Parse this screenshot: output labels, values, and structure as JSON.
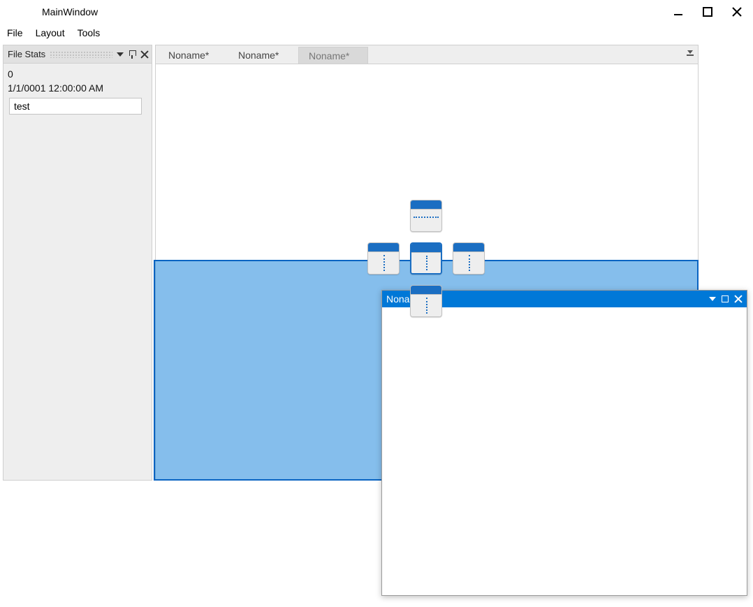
{
  "window": {
    "title": "MainWindow"
  },
  "menu": {
    "items": [
      "File",
      "Layout",
      "Tools"
    ]
  },
  "sidebar": {
    "title": "File Stats",
    "stats": {
      "count": "0",
      "timestamp": "1/1/0001 12:00:00 AM",
      "input_value": "test"
    }
  },
  "tabs": {
    "items": [
      {
        "label": "Noname*",
        "active": false
      },
      {
        "label": "Noname*",
        "active": false
      },
      {
        "label": "Noname*",
        "active": true
      }
    ]
  },
  "floating": {
    "title": "Noname*"
  }
}
